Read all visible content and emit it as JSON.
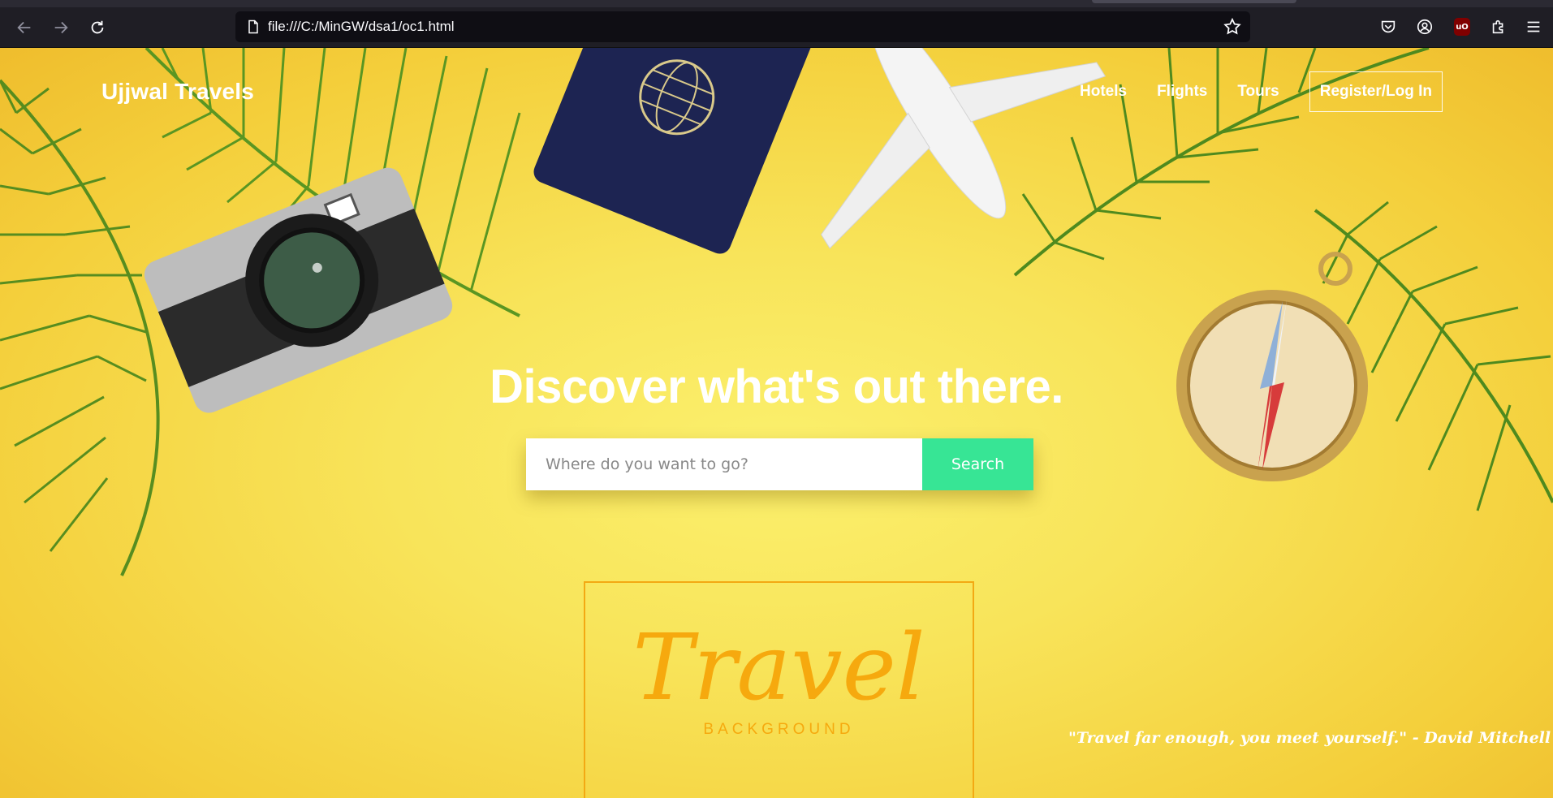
{
  "browser": {
    "url": "file:///C:/MinGW/dsa1/oc1.html",
    "toolbar_icons": [
      "back-icon",
      "forward-icon",
      "reload-icon",
      "page-icon",
      "bookmark-star-icon",
      "pocket-icon",
      "account-icon",
      "ublock-icon",
      "extensions-icon",
      "menu-icon"
    ],
    "ublock_label": "uO"
  },
  "header": {
    "brand": "Ujjwal Travels",
    "nav": [
      "Hotels",
      "Flights",
      "Tours"
    ],
    "login": "Register/Log In"
  },
  "hero": {
    "title": "Discover what's out there.",
    "search_placeholder": "Where do you want to go?",
    "search_button": "Search"
  },
  "logo": {
    "title": "Travel",
    "subtitle": "BACKGROUND"
  },
  "quote": "\"Travel far enough, you meet yourself.\" - David Mitchell",
  "colors": {
    "background_yellow": "#f6dc4c",
    "search_button": "#37e595",
    "logo_orange": "#f6a90e",
    "palm_green": "#4f8a1e"
  }
}
